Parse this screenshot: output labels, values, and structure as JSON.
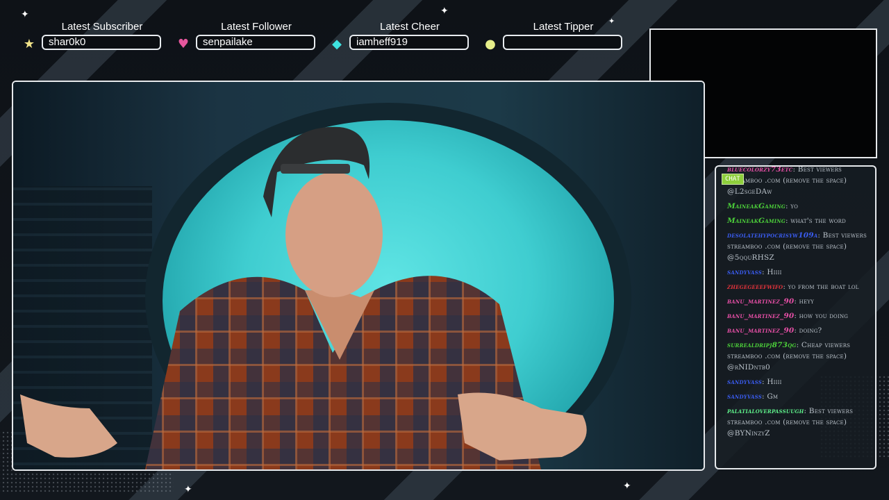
{
  "widgets": [
    {
      "label": "Latest Subscriber",
      "value": "shar0k0",
      "icon": "star-icon",
      "color": "#f2e48a",
      "glyph": "★"
    },
    {
      "label": "Latest Follower",
      "value": "senpailake",
      "icon": "heart-icon",
      "color": "#e6579d",
      "glyph": "♥"
    },
    {
      "label": "Latest Cheer",
      "value": "iamheff919",
      "icon": "diamond-icon",
      "color": "#3ee3e0",
      "glyph": "◆"
    },
    {
      "label": "Latest Tipper",
      "value": "",
      "icon": "coin-icon",
      "color": "#e6ee8a",
      "glyph": "●"
    }
  ],
  "chat": {
    "tab_label": "CHAT",
    "messages": [
      {
        "user": "bluecolorzy73etc",
        "text": "Best viewers streamboo .com (remove the space) @L2sgeDAw",
        "color": "#e64fa6"
      },
      {
        "user": "MaineakGaming",
        "text": "yo",
        "color": "#4ccf3a"
      },
      {
        "user": "MaineakGaming",
        "text": "what's the word",
        "color": "#4ccf3a"
      },
      {
        "user": "desolatehypocrisyw109a",
        "text": "Best viewers streamboo .com (remove the space) @5qquRHSZ",
        "color": "#3a5cf0"
      },
      {
        "user": "sandyvass",
        "text": "Hiiii",
        "color": "#3a5cf0"
      },
      {
        "user": "zhegegeeefwifo",
        "text": "yo from the boat lol",
        "color": "#e2333b"
      },
      {
        "user": "banu_martinez_90",
        "text": "heyy",
        "color": "#e64fa6"
      },
      {
        "user": "banu_martinez_90",
        "text": "how you doing",
        "color": "#e64fa6"
      },
      {
        "user": "banu_martinez_90",
        "text": "doing?",
        "color": "#e64fa6"
      },
      {
        "user": "surrealdripj873qg",
        "text": "Cheap viewers streamboo .com (remove the space) @rNIDntb0",
        "color": "#4ccf3a"
      },
      {
        "user": "sandyvass",
        "text": "Hiiii",
        "color": "#3a5cf0"
      },
      {
        "user": "sandyvass",
        "text": "Gm",
        "color": "#3a5cf0"
      },
      {
        "user": "palatialoverpassuugh",
        "text": "Best viewers streamboo .com (remove the space) @BYNinzyZ",
        "color": "#5ef08a"
      }
    ]
  }
}
